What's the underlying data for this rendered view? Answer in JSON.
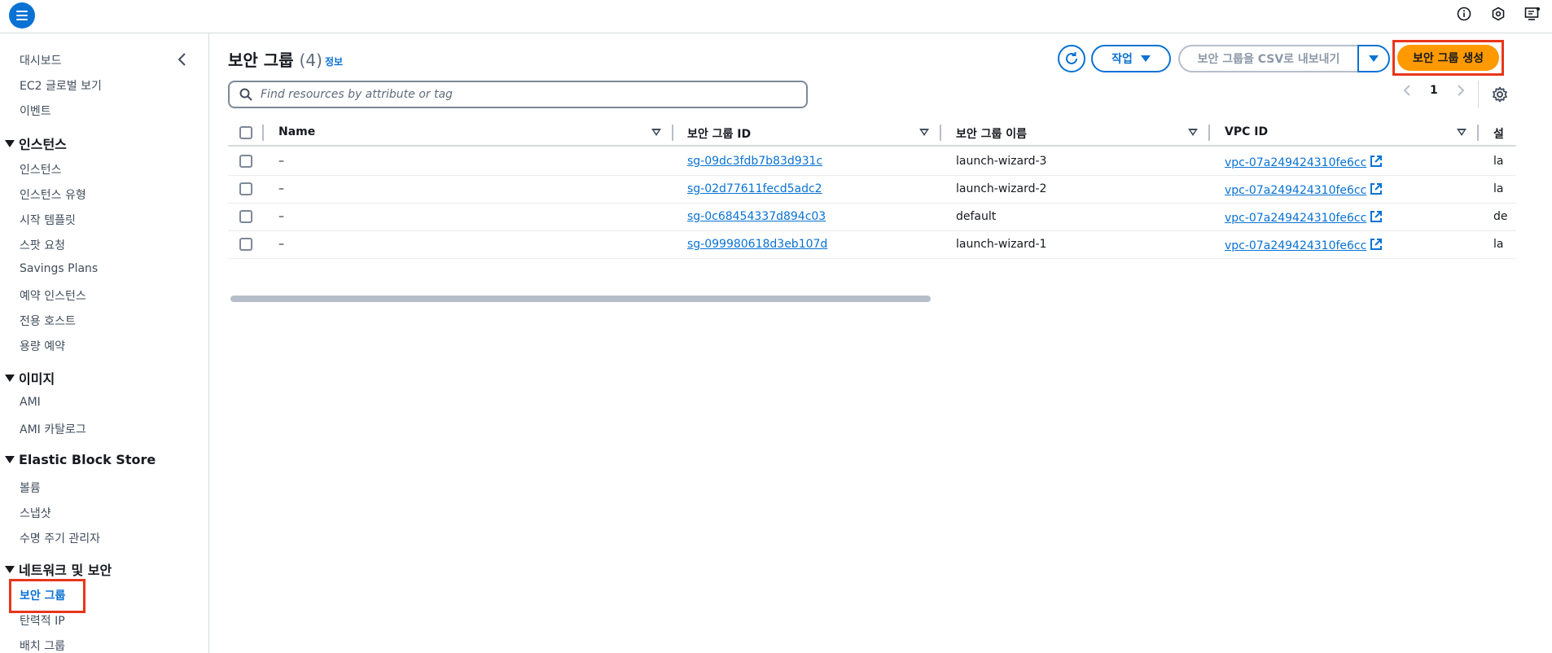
{
  "topbar": {
    "icons": [
      "menu-icon",
      "info-icon",
      "hexagon-settings-icon",
      "feedback-icon"
    ]
  },
  "sidebar": {
    "top_items": [
      "대시보드",
      "EC2 글로벌 보기",
      "이벤트"
    ],
    "sections": [
      {
        "title": "인스턴스",
        "items": [
          "인스턴스",
          "인스턴스 유형",
          "시작 템플릿",
          "스팟 요청",
          "Savings Plans",
          "예약 인스턴스",
          "전용 호스트",
          "용량 예약"
        ]
      },
      {
        "title": "이미지",
        "items": [
          "AMI",
          "AMI 카탈로그"
        ]
      },
      {
        "title": "Elastic Block Store",
        "items": [
          "볼륨",
          "스냅샷",
          "수명 주기 관리자"
        ]
      },
      {
        "title": "네트워크 및 보안",
        "items": [
          "보안 그룹",
          "탄력적 IP",
          "배치 그룹"
        ]
      }
    ],
    "active_item": "보안 그룹"
  },
  "main": {
    "title": "보안 그룹",
    "count": "(4)",
    "info_label": "정보",
    "actions_label": "작업",
    "export_label": "보안 그룹을 CSV로 내보내기",
    "create_label": "보안 그룹 생성",
    "search_placeholder": "Find resources by attribute or tag",
    "page_number": "1"
  },
  "table": {
    "columns": [
      "Name",
      "보안 그룹 ID",
      "보안 그룹 이름",
      "VPC ID",
      "설"
    ],
    "rows": [
      {
        "name": "–",
        "sg_id": "sg-09dc3fdb7b83d931c",
        "sg_name": "launch-wizard-3",
        "vpc_id": "vpc-07a249424310fe6cc",
        "desc": "la"
      },
      {
        "name": "–",
        "sg_id": "sg-02d77611fecd5adc2",
        "sg_name": "launch-wizard-2",
        "vpc_id": "vpc-07a249424310fe6cc",
        "desc": "la"
      },
      {
        "name": "–",
        "sg_id": "sg-0c68454337d894c03",
        "sg_name": "default",
        "vpc_id": "vpc-07a249424310fe6cc",
        "desc": "de"
      },
      {
        "name": "–",
        "sg_id": "sg-099980618d3eb107d",
        "sg_name": "launch-wizard-1",
        "vpc_id": "vpc-07a249424310fe6cc",
        "desc": "la"
      }
    ]
  },
  "colors": {
    "link": "#0972d3",
    "primary_button": "#ff9900",
    "highlight": "#e8361b"
  }
}
